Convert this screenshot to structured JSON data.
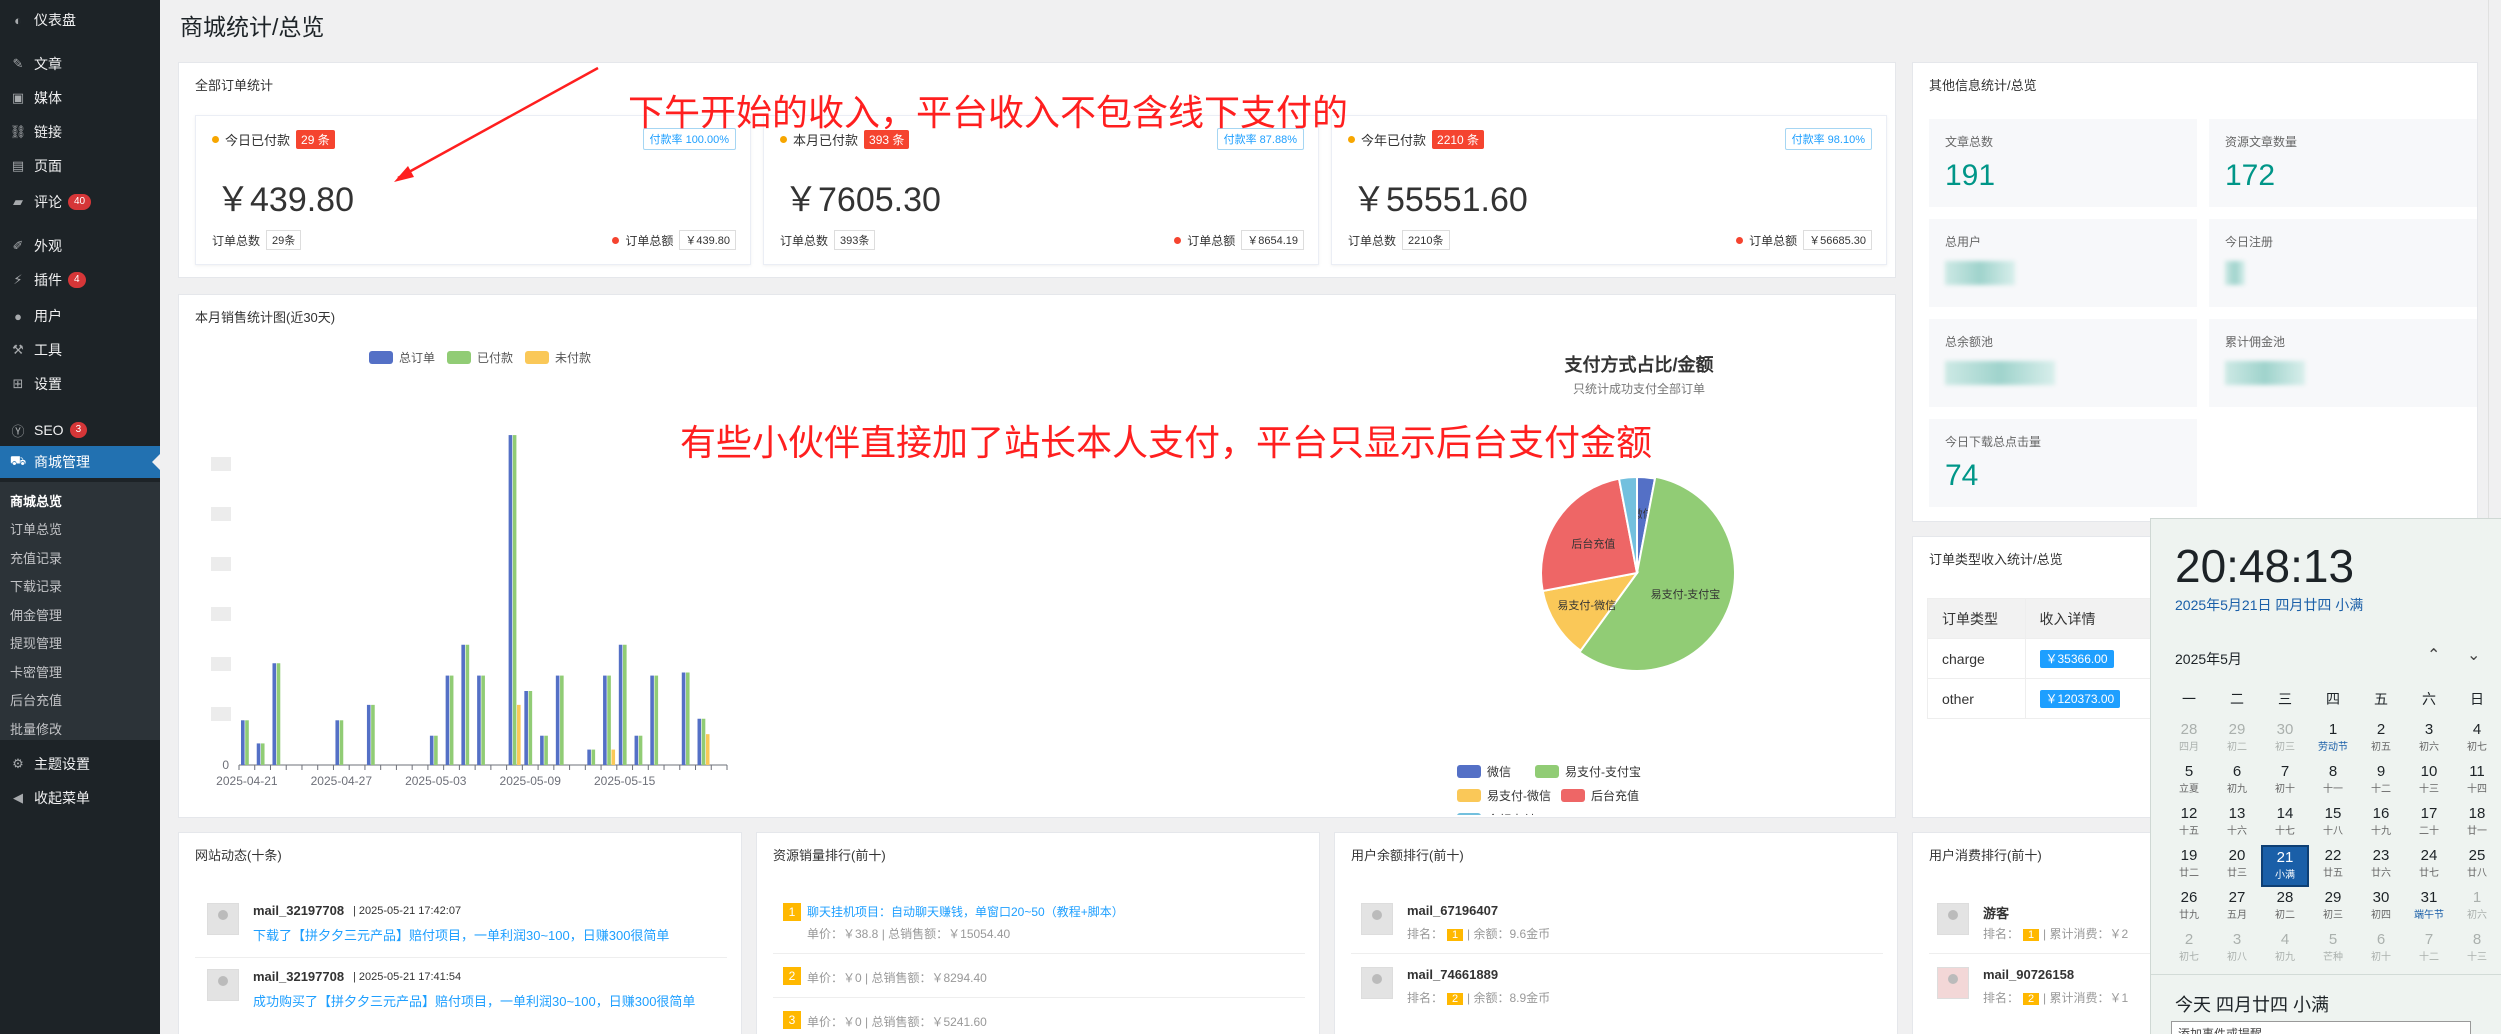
{
  "sidebar": {
    "items": [
      {
        "label": "仪表盘",
        "icon": "dashboard-icon"
      },
      {
        "label": "文章",
        "icon": "pin-icon"
      },
      {
        "label": "媒体",
        "icon": "media-icon"
      },
      {
        "label": "链接",
        "icon": "link-icon"
      },
      {
        "label": "页面",
        "icon": "page-icon"
      },
      {
        "label": "评论",
        "icon": "comment-icon",
        "badge": "40"
      },
      {
        "label": "外观",
        "icon": "brush-icon"
      },
      {
        "label": "插件",
        "icon": "plugin-icon",
        "badge": "4"
      },
      {
        "label": "用户",
        "icon": "user-icon"
      },
      {
        "label": "工具",
        "icon": "wrench-icon"
      },
      {
        "label": "设置",
        "icon": "settings-icon"
      },
      {
        "label": "SEO",
        "icon": "seo-icon",
        "badge": "3"
      },
      {
        "label": "商城管理",
        "icon": "cart-icon"
      },
      {
        "label": "主题设置",
        "icon": "gear-icon"
      },
      {
        "label": "收起菜单",
        "icon": "collapse-icon"
      }
    ],
    "submenu": [
      "商城总览",
      "订单总览",
      "充值记录",
      "下载记录",
      "佣金管理",
      "提现管理",
      "卡密管理",
      "后台充值",
      "批量修改"
    ]
  },
  "page_title": "商城统计/总览",
  "orders_panel": {
    "title": "全部订单统计",
    "cards": [
      {
        "label": "今日已付款",
        "count": "29 条",
        "rate": "付款率 100.00%",
        "amount": "￥439.80",
        "total_label": "订单总数",
        "total": "29条",
        "sum_label": "订单总额",
        "sum": "￥439.80"
      },
      {
        "label": "本月已付款",
        "count": "393 条",
        "rate": "付款率 87.88%",
        "amount": "￥7605.30",
        "total_label": "订单总数",
        "total": "393条",
        "sum_label": "订单总额",
        "sum": "￥8654.19"
      },
      {
        "label": "今年已付款",
        "count": "2210 条",
        "rate": "付款率 98.10%",
        "amount": "￥55551.60",
        "total_label": "订单总数",
        "total": "2210条",
        "sum_label": "订单总额",
        "sum": "￥56685.30"
      }
    ]
  },
  "annotations": {
    "top": "下午开始的收入，平台收入不包含线下支付的",
    "middle": "有些小伙伴直接加了站长本人支付，平台只显示后台支付金额"
  },
  "sales_panel": {
    "title": "本月销售统计图(近30天)"
  },
  "colors": {
    "blue": "#5470c6",
    "green": "#91cc75",
    "yellow": "#fac858",
    "red": "#ee6666",
    "cyan": "#73c0de",
    "teal": "#009688",
    "accent": "#2271b1"
  },
  "chart_data": [
    {
      "type": "bar",
      "title": "",
      "categories": [
        "2025-04-21",
        "2025-04-22",
        "2025-04-23",
        "2025-04-24",
        "2025-04-25",
        "2025-04-26",
        "2025-04-27",
        "2025-04-28",
        "2025-04-29",
        "2025-04-30",
        "2025-05-01",
        "2025-05-02",
        "2025-05-03",
        "2025-05-04",
        "2025-05-05",
        "2025-05-06",
        "2025-05-07",
        "2025-05-08",
        "2025-05-09",
        "2025-05-10",
        "2025-05-11",
        "2025-05-12",
        "2025-05-13",
        "2025-05-14",
        "2025-05-15",
        "2025-05-16",
        "2025-05-17",
        "2025-05-18",
        "2025-05-19",
        "2025-05-20",
        "2025-05-21"
      ],
      "x_tick_labels": [
        "2025-04-21",
        "2025-04-27",
        "2025-05-03",
        "2025-05-09",
        "2025-05-15"
      ],
      "y_tick_labels": [
        "0"
      ],
      "ylim": [
        0,
        240
      ],
      "series": [
        {
          "name": "总订单",
          "values": [
            29,
            14,
            66,
            0,
            0,
            0,
            29,
            0,
            39,
            0,
            0,
            0,
            19,
            58,
            78,
            58,
            0,
            214,
            48,
            19,
            58,
            0,
            10,
            58,
            78,
            19,
            58,
            0,
            60,
            30,
            0
          ]
        },
        {
          "name": "已付款",
          "values": [
            29,
            14,
            66,
            0,
            0,
            0,
            29,
            0,
            39,
            0,
            0,
            0,
            19,
            58,
            78,
            58,
            0,
            214,
            48,
            19,
            58,
            0,
            10,
            58,
            78,
            19,
            58,
            0,
            60,
            30,
            0
          ]
        },
        {
          "name": "未付款",
          "values": [
            0,
            0,
            0,
            0,
            0,
            0,
            0,
            0,
            0,
            0,
            0,
            0,
            0,
            0,
            0,
            0,
            0,
            39,
            0,
            0,
            0,
            0,
            0,
            10,
            0,
            0,
            0,
            0,
            0,
            20,
            0
          ]
        }
      ],
      "legend": "top",
      "grid": false
    },
    {
      "type": "pie",
      "title": "支付方式占比/金额",
      "subtitle": "只统计成功支付全部订单",
      "slices": [
        {
          "name": "微信",
          "value": 3,
          "color": "#5470c6"
        },
        {
          "name": "易支付-支付宝",
          "value": 57,
          "color": "#91cc75"
        },
        {
          "name": "易支付-微信",
          "value": 12,
          "color": "#fac858"
        },
        {
          "name": "后台充值",
          "value": 25,
          "color": "#ee6666"
        },
        {
          "name": "余额支付",
          "value": 3,
          "color": "#73c0de"
        }
      ],
      "slice_labels": [
        "微信",
        "易支付-支付宝",
        "易支付-微信",
        "后台充值"
      ],
      "legend": "bottom"
    }
  ],
  "other_panel": {
    "title": "其他信息统计/总览",
    "tiles": [
      {
        "label": "文章总数",
        "value": "191"
      },
      {
        "label": "资源文章数量",
        "value": "172"
      },
      {
        "label": "总用户",
        "value": ""
      },
      {
        "label": "今日注册",
        "value": ""
      },
      {
        "label": "总余额池",
        "value": ""
      },
      {
        "label": "累计佣金池",
        "value": ""
      },
      {
        "label": "今日下载总点击量",
        "value": "74"
      }
    ]
  },
  "order_type_panel": {
    "title": "订单类型收入统计/总览",
    "headers": [
      "订单类型",
      "收入详情"
    ],
    "rows": [
      {
        "type": "charge",
        "amount": "￥35366.00"
      },
      {
        "type": "other",
        "amount": "￥120373.00"
      }
    ]
  },
  "activity_panel": {
    "title": "网站动态(十条)",
    "items": [
      {
        "user": "mail_32197708",
        "time": "| 2025-05-21 17:42:07",
        "text": "下载了【拼夕夕三元产品】赔付项目，一单利润30~100，日赚300很简单"
      },
      {
        "user": "mail_32197708",
        "time": "| 2025-05-21 17:41:54",
        "text": "成功购买了【拼夕夕三元产品】赔付项目，一单利润30~100，日赚300很简单"
      }
    ]
  },
  "ranking_panel": {
    "title": "资源销量排行(前十)",
    "items": [
      {
        "rank": "1",
        "name": "聊天挂机项目：自动聊天赚钱，单窗口20~50（教程+脚本）",
        "info": "单价：￥38.8 | 总销售额：￥15054.40"
      },
      {
        "rank": "2",
        "name": "",
        "info": "单价：￥0 | 总销售额：￥8294.40"
      },
      {
        "rank": "3",
        "name": "",
        "info": "单价：￥0 | 总销售额：￥5241.60"
      }
    ]
  },
  "balance_panel": {
    "title": "用户余额排行(前十)",
    "items": [
      {
        "user": "mail_67196407",
        "rank_label": "排名：",
        "rank": "1",
        "info": "| 余额：9.6金币"
      },
      {
        "user": "mail_74661889",
        "rank_label": "排名：",
        "rank": "2",
        "info": "| 余额：8.9金币"
      }
    ]
  },
  "spend_panel": {
    "title": "用户消费排行(前十)",
    "items": [
      {
        "user": "游客",
        "rank_label": "排名：",
        "rank": "1",
        "info": "| 累计消费：￥2"
      },
      {
        "user": "mail_90726158",
        "rank_label": "排名：",
        "rank": "2",
        "info": "| 累计消费：￥1"
      }
    ]
  },
  "clock": {
    "time": "20:48:13",
    "date": "2025年5月21日 四月廿四 小满",
    "month": "2025年5月",
    "weekdays": [
      "一",
      "二",
      "三",
      "四",
      "五",
      "六",
      "日"
    ],
    "days": [
      {
        "n": "28",
        "l": "四月",
        "dim": true
      },
      {
        "n": "29",
        "l": "初二",
        "dim": true
      },
      {
        "n": "30",
        "l": "初三",
        "dim": true
      },
      {
        "n": "1",
        "l": "劳动节",
        "hol": true
      },
      {
        "n": "2",
        "l": "初五"
      },
      {
        "n": "3",
        "l": "初六"
      },
      {
        "n": "4",
        "l": "初七"
      },
      {
        "n": "5",
        "l": "立夏"
      },
      {
        "n": "6",
        "l": "初九"
      },
      {
        "n": "7",
        "l": "初十"
      },
      {
        "n": "8",
        "l": "十一"
      },
      {
        "n": "9",
        "l": "十二"
      },
      {
        "n": "10",
        "l": "十三"
      },
      {
        "n": "11",
        "l": "十四"
      },
      {
        "n": "12",
        "l": "十五"
      },
      {
        "n": "13",
        "l": "十六"
      },
      {
        "n": "14",
        "l": "十七"
      },
      {
        "n": "15",
        "l": "十八"
      },
      {
        "n": "16",
        "l": "十九"
      },
      {
        "n": "17",
        "l": "二十"
      },
      {
        "n": "18",
        "l": "廿一"
      },
      {
        "n": "19",
        "l": "廿二"
      },
      {
        "n": "20",
        "l": "廿三"
      },
      {
        "n": "21",
        "l": "小满",
        "today": true
      },
      {
        "n": "22",
        "l": "廿五"
      },
      {
        "n": "23",
        "l": "廿六"
      },
      {
        "n": "24",
        "l": "廿七"
      },
      {
        "n": "25",
        "l": "廿八"
      },
      {
        "n": "26",
        "l": "廿九"
      },
      {
        "n": "27",
        "l": "五月"
      },
      {
        "n": "28",
        "l": "初二"
      },
      {
        "n": "29",
        "l": "初三"
      },
      {
        "n": "30",
        "l": "初四"
      },
      {
        "n": "31",
        "l": "端午节",
        "hol": true
      },
      {
        "n": "1",
        "l": "初六",
        "dim": true
      },
      {
        "n": "2",
        "l": "初七",
        "dim": true
      },
      {
        "n": "3",
        "l": "初八",
        "dim": true
      },
      {
        "n": "4",
        "l": "初九",
        "dim": true
      },
      {
        "n": "5",
        "l": "芒种",
        "dim": true
      },
      {
        "n": "6",
        "l": "初十",
        "dim": true
      },
      {
        "n": "7",
        "l": "十二",
        "dim": true
      },
      {
        "n": "8",
        "l": "十三",
        "dim": true
      }
    ],
    "today_line": "今天 四月廿四 小满",
    "input_placeholder": "添加事件或提醒"
  }
}
